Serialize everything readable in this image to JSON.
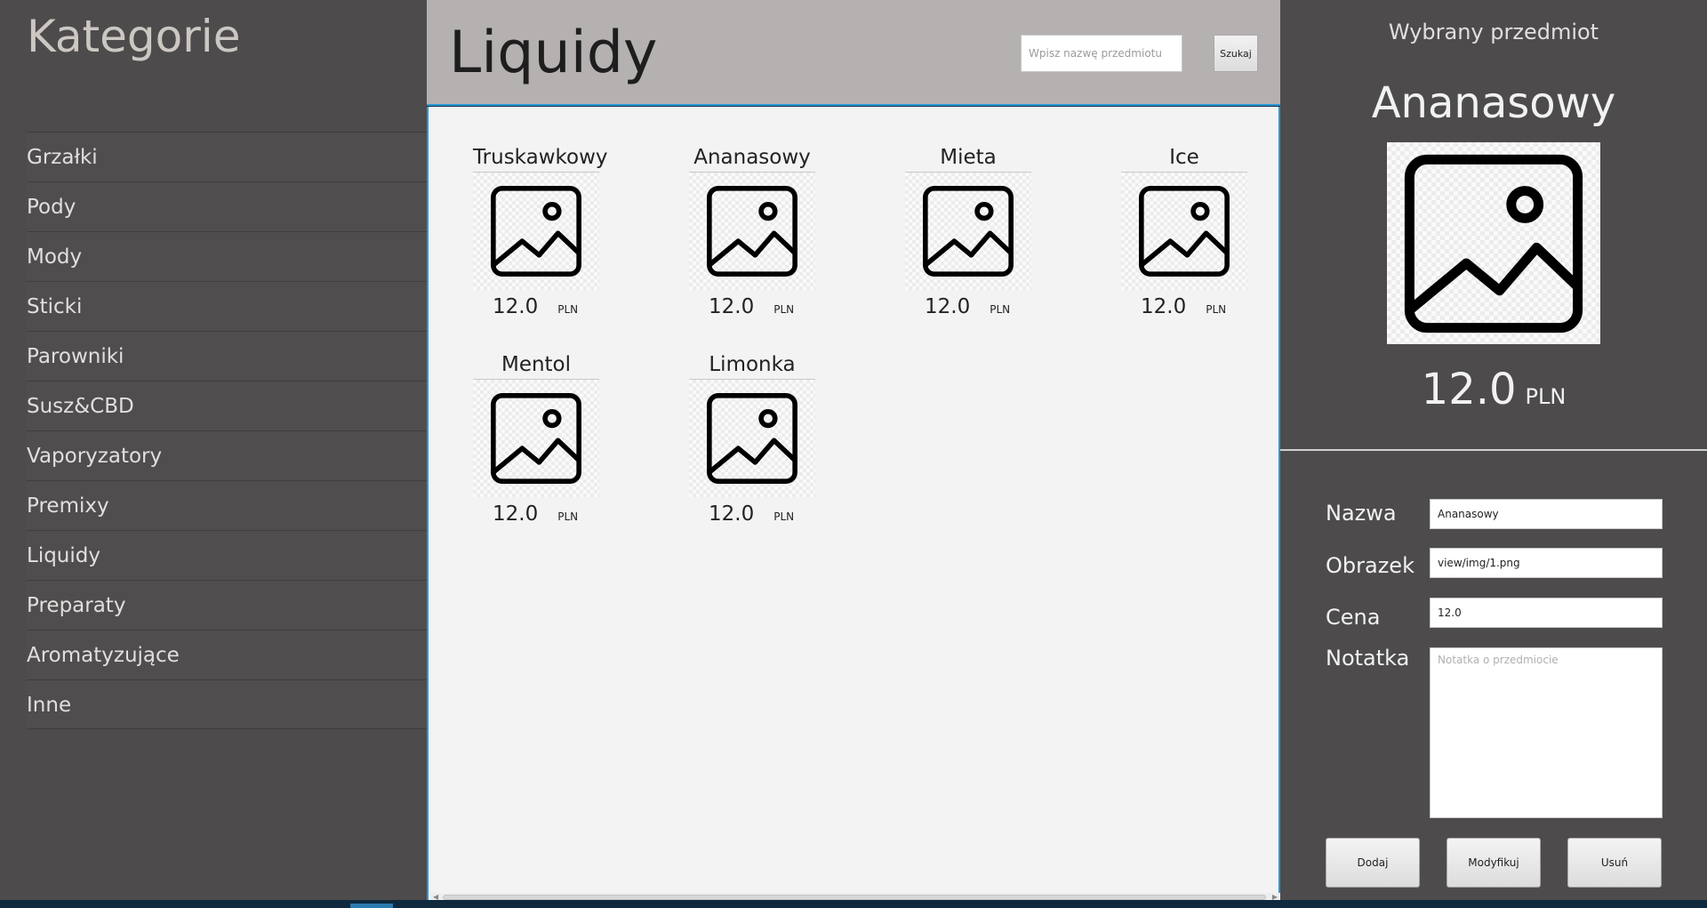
{
  "sidebar": {
    "title": "Kategorie",
    "items": [
      {
        "label": "Grzałki"
      },
      {
        "label": "Pody"
      },
      {
        "label": "Mody"
      },
      {
        "label": "Sticki"
      },
      {
        "label": "Parowniki"
      },
      {
        "label": "Susz&CBD"
      },
      {
        "label": "Vaporyzatory"
      },
      {
        "label": "Premixy"
      },
      {
        "label": "Liquidy"
      },
      {
        "label": "Preparaty"
      },
      {
        "label": "Aromatyzujące"
      },
      {
        "label": "Inne"
      }
    ]
  },
  "main": {
    "title": "Liquidy",
    "search": {
      "placeholder": "Wpisz nazwę przedmiotu",
      "value": "",
      "button_label": "Szukaj"
    },
    "products": [
      {
        "name": "Truskawkowy",
        "price": "12.0",
        "currency": "PLN",
        "icon": "image-placeholder-icon"
      },
      {
        "name": "Ananasowy",
        "price": "12.0",
        "currency": "PLN",
        "icon": "image-placeholder-icon"
      },
      {
        "name": "Mieta",
        "price": "12.0",
        "currency": "PLN",
        "icon": "image-placeholder-icon"
      },
      {
        "name": "Ice",
        "price": "12.0",
        "currency": "PLN",
        "icon": "image-placeholder-icon"
      },
      {
        "name": "Mentol",
        "price": "12.0",
        "currency": "PLN",
        "icon": "image-placeholder-icon"
      },
      {
        "name": "Limonka",
        "price": "12.0",
        "currency": "PLN",
        "icon": "image-placeholder-icon"
      }
    ]
  },
  "details": {
    "label": "Wybrany przedmiot",
    "name": "Ananasowy",
    "price": "12.0",
    "currency": "PLN",
    "icon": "image-placeholder-icon",
    "form": {
      "name_label": "Nazwa",
      "name_value": "Ananasowy",
      "image_label": "Obrazek",
      "image_value": "view/img/1.png",
      "price_label": "Cena",
      "price_value": "12.0",
      "note_label": "Notatka",
      "note_placeholder": "Notatka o przedmiocie",
      "note_value": ""
    },
    "buttons": {
      "add": "Dodaj",
      "modify": "Modyfikuj",
      "delete": "Usuń"
    }
  }
}
